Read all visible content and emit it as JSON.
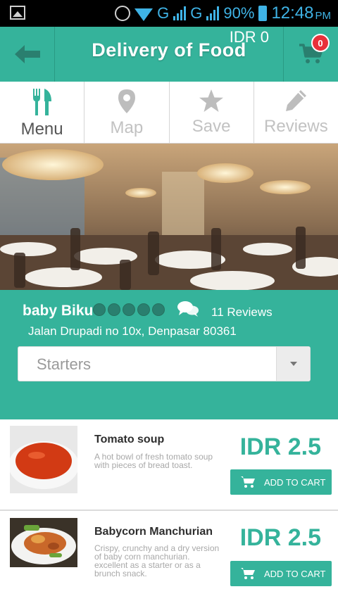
{
  "status_bar": {
    "network_1": "G",
    "network_2": "G",
    "battery": "90%",
    "time": "12:48",
    "ampm": "PM"
  },
  "header": {
    "title": "Delivery of Food",
    "cart_total": "IDR 0",
    "cart_count": "0"
  },
  "tabs": [
    {
      "label": "Menu",
      "icon": "fork-knife-icon",
      "active": true
    },
    {
      "label": "Map",
      "icon": "map-pin-icon",
      "active": false
    },
    {
      "label": "Save",
      "icon": "star-icon",
      "active": false
    },
    {
      "label": "Reviews",
      "icon": "pencil-icon",
      "active": false
    }
  ],
  "restaurant": {
    "name": "baby Biku",
    "rating": 5,
    "reviews_label": "11 Reviews",
    "address": "Jalan Drupadi no 10x, Denpasar 80361"
  },
  "category_select": {
    "value": "Starters"
  },
  "menu_items": [
    {
      "title": "Tomato soup",
      "description": "A hot bowl of fresh tomato soup with pieces of bread toast.",
      "price": "IDR 2.5",
      "button_label": "ADD TO CART"
    },
    {
      "title": "Babycorn Manchurian",
      "description": "Crispy, crunchy and a dry version of baby corn manchurian. excellent as a starter or as a brunch snack.",
      "price": "IDR 2.5",
      "button_label": "ADD TO CART"
    }
  ],
  "colors": {
    "accent": "#35b39b",
    "badge": "#e8313a",
    "tab_active": "#555555",
    "tab_inactive": "#c2c2c2"
  }
}
